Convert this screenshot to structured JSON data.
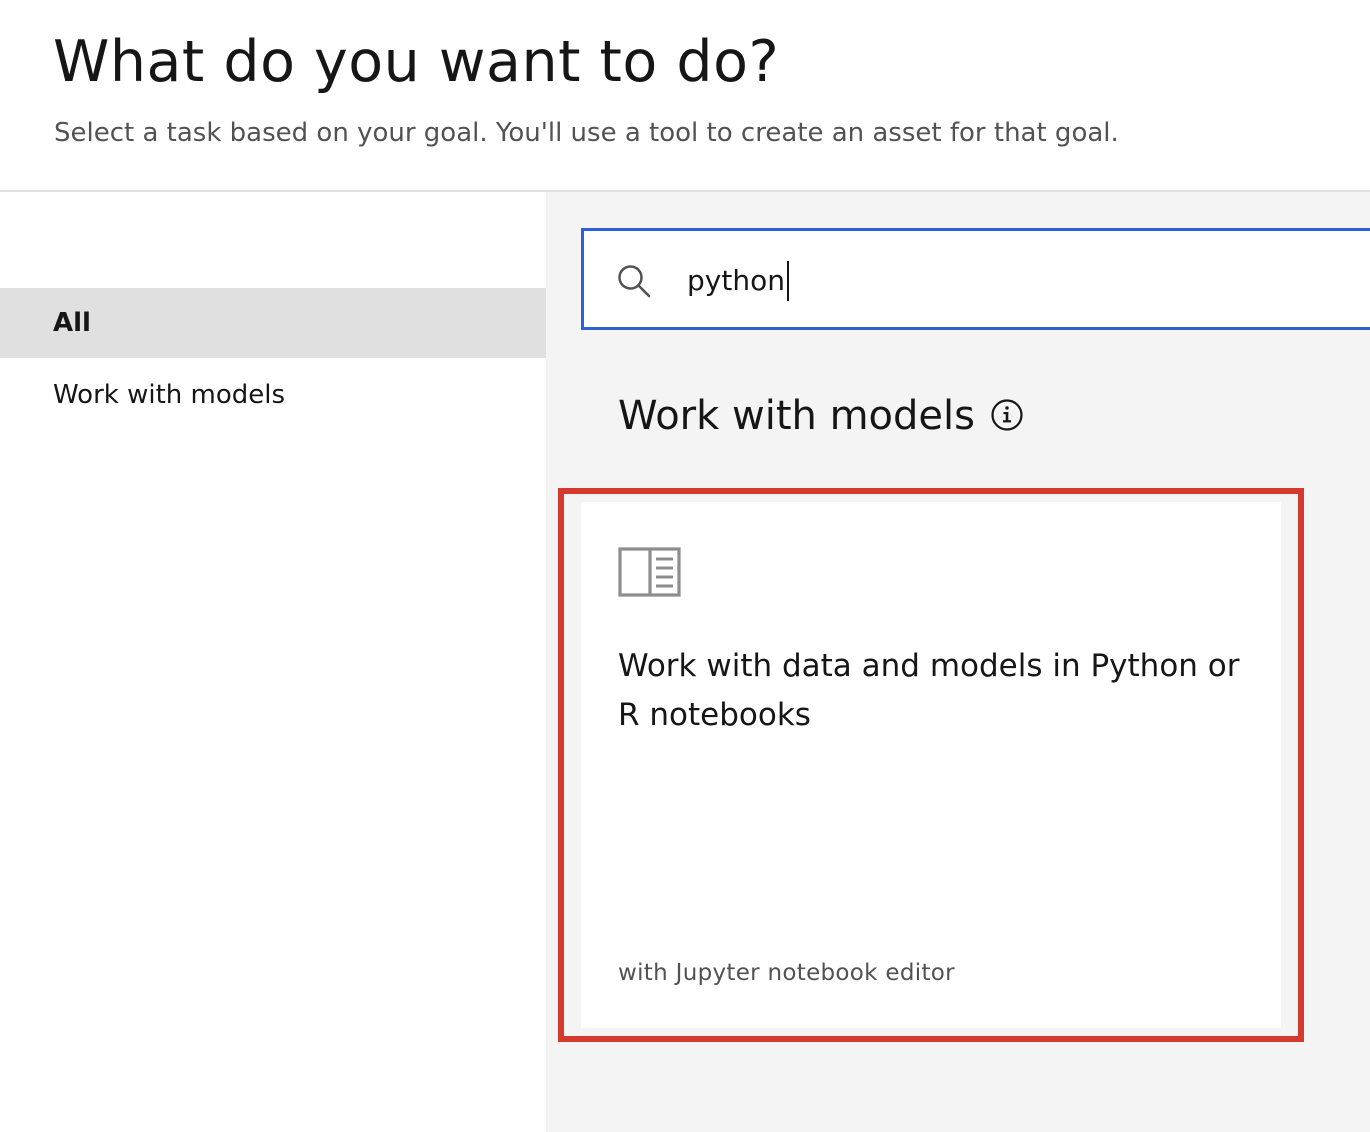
{
  "header": {
    "title": "What do you want to do?",
    "subtitle": "Select a task based on your goal. You'll use a tool to create an asset for that goal."
  },
  "sidebar": {
    "items": [
      {
        "label": "All",
        "active": true
      },
      {
        "label": "Work with models",
        "active": false
      }
    ]
  },
  "search": {
    "value": "python",
    "icon": "search-icon"
  },
  "section": {
    "title": "Work with models",
    "info_icon": "info-icon"
  },
  "card": {
    "icon": "notebook-icon",
    "title": "Work with data and models in Python or R notebooks",
    "subtitle": "with Jupyter notebook editor",
    "highlighted": true
  },
  "colors": {
    "focus_border": "#2d62d6",
    "highlight_border": "#d63a2e",
    "main_background": "#f4f4f4",
    "active_item_background": "#e0e0e0"
  }
}
